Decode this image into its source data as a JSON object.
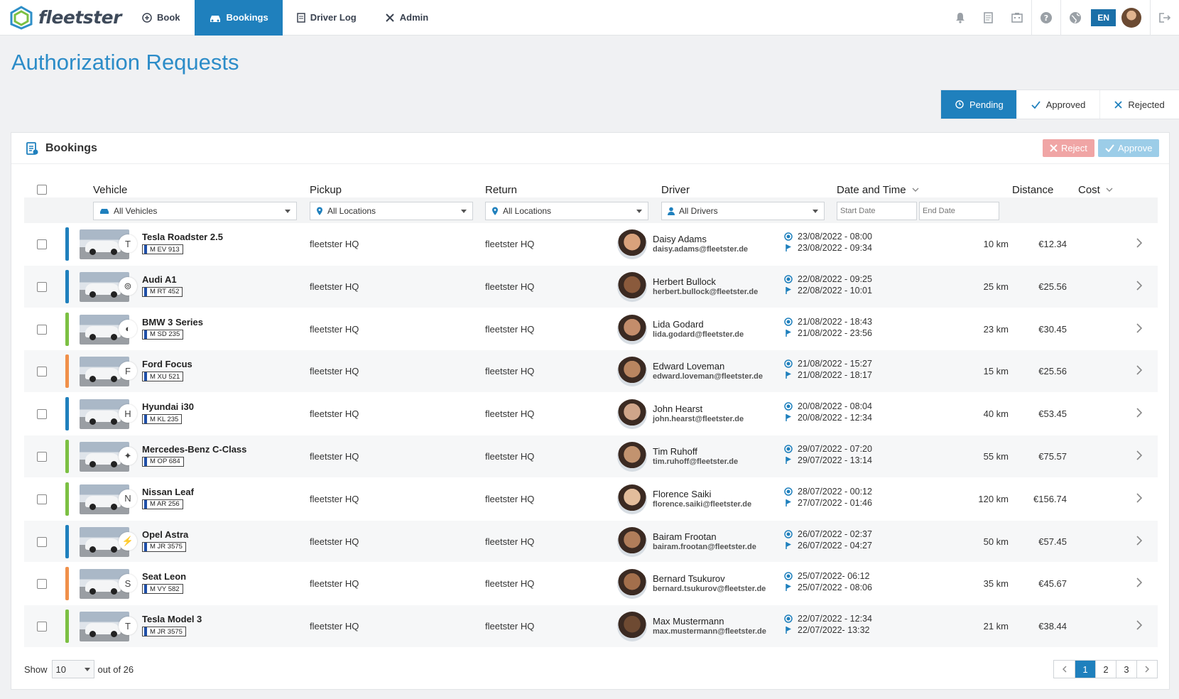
{
  "app": {
    "name": "fleetster"
  },
  "nav": {
    "items": [
      "Book",
      "Bookings",
      "Driver Log",
      "Admin"
    ],
    "active": "Bookings",
    "language": "EN"
  },
  "page": {
    "title": "Authorization Requests"
  },
  "status_tabs": [
    {
      "label": "Pending",
      "active": true
    },
    {
      "label": "Approved",
      "active": false
    },
    {
      "label": "Rejected",
      "active": false
    }
  ],
  "card": {
    "title": "Bookings",
    "reject_label": "Reject",
    "approve_label": "Approve"
  },
  "columns": {
    "vehicle": "Vehicle",
    "pickup": "Pickup",
    "return": "Return",
    "driver": "Driver",
    "datetime": "Date and Time",
    "distance": "Distance",
    "cost": "Cost"
  },
  "filters": {
    "vehicles": "All Vehicles",
    "pickup": "All Locations",
    "return": "All Locations",
    "drivers": "All Drivers",
    "start_placeholder": "Start Date",
    "end_placeholder": "End Date"
  },
  "colors": {
    "accent": "#1f80bd",
    "blue": "#1f80bd",
    "green": "#7cc043",
    "orange": "#f0904a"
  },
  "rows": [
    {
      "vehicle": "Tesla Roadster 2.5",
      "plate": "M EV 913",
      "brand": "tesla-icon",
      "bar": "blue",
      "pickup": "fleetster HQ",
      "return": "fleetster HQ",
      "driver": "Daisy Adams",
      "email": "daisy.adams@fleetster.de",
      "start": "23/08/2022 - 08:00",
      "end": "23/08/2022 - 09:34",
      "distance": "10 km",
      "cost": "€12.34"
    },
    {
      "vehicle": "Audi A1",
      "plate": "M RT 452",
      "brand": "audi-icon",
      "bar": "blue",
      "pickup": "fleetster HQ",
      "return": "fleetster HQ",
      "driver": "Herbert Bullock",
      "email": "herbert.bullock@fleetster.de",
      "start": "22/08/2022 - 09:25",
      "end": "22/08/2022 - 10:01",
      "distance": "25 km",
      "cost": "€25.56"
    },
    {
      "vehicle": "BMW 3 Series",
      "plate": "M SD 235",
      "brand": "bmw-icon",
      "bar": "green",
      "pickup": "fleetster HQ",
      "return": "fleetster HQ",
      "driver": "Lida Godard",
      "email": "lida.godard@fleetster.de",
      "start": "21/08/2022 - 18:43",
      "end": "21/08/2022 - 23:56",
      "distance": "23 km",
      "cost": "€30.45"
    },
    {
      "vehicle": "Ford Focus",
      "plate": "M XU 521",
      "brand": "ford-icon",
      "bar": "orange",
      "pickup": "fleetster HQ",
      "return": "fleetster HQ",
      "driver": "Edward Loveman",
      "email": "edward.loveman@fleetster.de",
      "start": "21/08/2022 - 15:27",
      "end": "21/08/2022 - 18:17",
      "distance": "15 km",
      "cost": "€25.56"
    },
    {
      "vehicle": "Hyundai i30",
      "plate": "M KL 235",
      "brand": "hyundai-icon",
      "bar": "blue",
      "pickup": "fleetster HQ",
      "return": "fleetster HQ",
      "driver": "John Hearst",
      "email": "john.hearst@fleetster.de",
      "start": "20/08/2022 - 08:04",
      "end": "20/08/2022 - 12:34",
      "distance": "40 km",
      "cost": "€53.45"
    },
    {
      "vehicle": "Mercedes-Benz C-Class",
      "plate": "M OP 684",
      "brand": "mercedes-icon",
      "bar": "green",
      "pickup": "fleetster HQ",
      "return": "fleetster HQ",
      "driver": "Tim Ruhoff",
      "email": "tim.ruhoff@fleetster.de",
      "start": "29/07/2022 - 07:20",
      "end": "29/07/2022 - 13:14",
      "distance": "55 km",
      "cost": "€75.57"
    },
    {
      "vehicle": "Nissan Leaf",
      "plate": "M AR 256",
      "brand": "nissan-icon",
      "bar": "green",
      "pickup": "fleetster HQ",
      "return": "fleetster HQ",
      "driver": "Florence Saiki",
      "email": "florence.saiki@fleetster.de",
      "start": "28/07/2022 - 00:12",
      "end": "27/07/2022 - 01:46",
      "distance": "120 km",
      "cost": "€156.74"
    },
    {
      "vehicle": "Opel Astra",
      "plate": "M JR 3575",
      "brand": "opel-icon",
      "bar": "blue",
      "pickup": "fleetster HQ",
      "return": "fleetster HQ",
      "driver": "Bairam Frootan",
      "email": "bairam.frootan@fleetster.de",
      "start": "26/07/2022 - 02:37",
      "end": "26/07/2022 - 04:27",
      "distance": "50 km",
      "cost": "€57.45"
    },
    {
      "vehicle": "Seat Leon",
      "plate": "M VY 582",
      "brand": "seat-icon",
      "bar": "orange",
      "pickup": "fleetster HQ",
      "return": "fleetster HQ",
      "driver": "Bernard Tsukurov",
      "email": "bernard.tsukurov@fleetster.de",
      "start": "25/07/2022- 06:12",
      "end": "25/07/2022 - 08:06",
      "distance": "35 km",
      "cost": "€45.67"
    },
    {
      "vehicle": "Tesla Model 3",
      "plate": "M JR 3575",
      "brand": "tesla-icon",
      "bar": "green",
      "pickup": "fleetster HQ",
      "return": "fleetster HQ",
      "driver": "Max Mustermann",
      "email": "max.mustermann@fleetster.de",
      "start": "22/07/2022 - 12:34",
      "end": "22/07/2022- 13:32",
      "distance": "21 km",
      "cost": "€38.44"
    }
  ],
  "footer": {
    "show_label": "Show",
    "page_size": "10",
    "total": "out of 26",
    "pages": [
      "1",
      "2",
      "3"
    ],
    "current_page": "1"
  }
}
